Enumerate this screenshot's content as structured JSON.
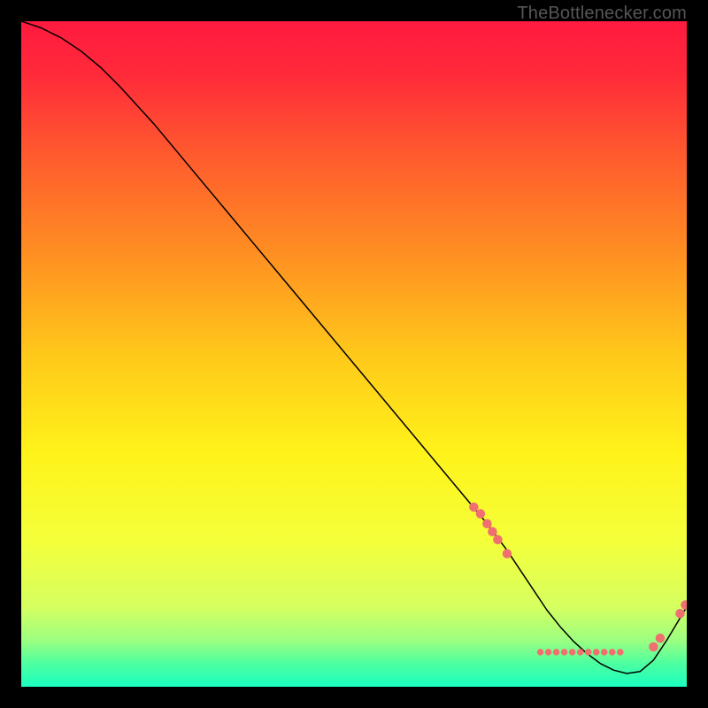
{
  "attribution": "TheBottlenecker.com",
  "chart_data": {
    "type": "line",
    "title": "",
    "xlabel": "",
    "ylabel": "",
    "xlim": [
      0,
      100
    ],
    "ylim": [
      0,
      100
    ],
    "gradient": [
      {
        "offset": 0.0,
        "color": "#ff1a3f"
      },
      {
        "offset": 0.08,
        "color": "#ff2a3a"
      },
      {
        "offset": 0.2,
        "color": "#ff5a2e"
      },
      {
        "offset": 0.35,
        "color": "#ff8f22"
      },
      {
        "offset": 0.5,
        "color": "#ffc81a"
      },
      {
        "offset": 0.65,
        "color": "#fff31a"
      },
      {
        "offset": 0.78,
        "color": "#f4ff3a"
      },
      {
        "offset": 0.88,
        "color": "#d6ff60"
      },
      {
        "offset": 0.93,
        "color": "#9cff80"
      },
      {
        "offset": 0.965,
        "color": "#4dffa0"
      },
      {
        "offset": 1.0,
        "color": "#1affc0"
      }
    ],
    "series": [
      {
        "name": "bottleneck-curve",
        "x": [
          0,
          3,
          6,
          9,
          12,
          15,
          20,
          25,
          30,
          35,
          40,
          45,
          50,
          55,
          60,
          65,
          70,
          73,
          75,
          77,
          79,
          81,
          83,
          85,
          87,
          89,
          91,
          93,
          95,
          97,
          100
        ],
        "y": [
          100,
          99,
          97.5,
          95.5,
          93,
          90,
          84.5,
          78.5,
          72.5,
          66.5,
          60.5,
          54.5,
          48.5,
          42.5,
          36.5,
          30.5,
          24.5,
          20.5,
          17.5,
          14.5,
          11.5,
          9.0,
          6.8,
          5.0,
          3.5,
          2.5,
          2.0,
          2.3,
          4.0,
          7.0,
          12.0
        ]
      }
    ],
    "points": {
      "name": "sample-points",
      "color": "#f07070",
      "radius_small": 5,
      "radius_large": 7,
      "items": [
        {
          "x": 68.0,
          "y": 27.0,
          "r": "l"
        },
        {
          "x": 69.0,
          "y": 26.0,
          "r": "l"
        },
        {
          "x": 70.0,
          "y": 24.5,
          "r": "l"
        },
        {
          "x": 70.8,
          "y": 23.3,
          "r": "l"
        },
        {
          "x": 71.6,
          "y": 22.1,
          "r": "l"
        },
        {
          "x": 73.0,
          "y": 20.0,
          "r": "l"
        },
        {
          "x": 78.0,
          "y": 5.2,
          "r": "s"
        },
        {
          "x": 79.2,
          "y": 5.2,
          "r": "s"
        },
        {
          "x": 80.4,
          "y": 5.2,
          "r": "s"
        },
        {
          "x": 81.6,
          "y": 5.2,
          "r": "s"
        },
        {
          "x": 82.8,
          "y": 5.2,
          "r": "s"
        },
        {
          "x": 84.0,
          "y": 5.2,
          "r": "s"
        },
        {
          "x": 85.2,
          "y": 5.2,
          "r": "s"
        },
        {
          "x": 86.4,
          "y": 5.2,
          "r": "s"
        },
        {
          "x": 87.6,
          "y": 5.2,
          "r": "s"
        },
        {
          "x": 88.8,
          "y": 5.2,
          "r": "s"
        },
        {
          "x": 90.0,
          "y": 5.2,
          "r": "s"
        },
        {
          "x": 95.0,
          "y": 6.0,
          "r": "l"
        },
        {
          "x": 96.0,
          "y": 7.3,
          "r": "l"
        },
        {
          "x": 99.0,
          "y": 11.0,
          "r": "l"
        },
        {
          "x": 99.8,
          "y": 12.3,
          "r": "l"
        }
      ]
    }
  }
}
